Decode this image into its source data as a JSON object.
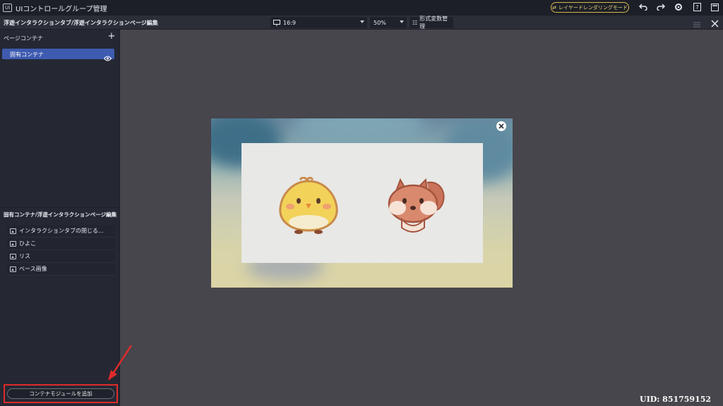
{
  "titlebar": {
    "logo": "UI",
    "title": "UIコントロールグループ管理",
    "mode_button": "レイヤードレンダリングモード",
    "icons": [
      "undo-icon",
      "redo-icon",
      "settings-icon",
      "help-icon",
      "minimize-icon"
    ]
  },
  "toolbar": {
    "breadcrumb": "浮遊インタラクションタブ/浮遊インタラクションページ編集",
    "aspect": "16:9",
    "zoom": "50%",
    "format_label": "形式変数管理"
  },
  "sidebar": {
    "header": "ページコンテナ",
    "pages": [
      {
        "label": "固有コンテナ",
        "selected": true
      }
    ],
    "section_title": "固有コンテナ/浮遊インタラクションページ編集",
    "items": [
      {
        "label": "インタラクションタブの閉じる...",
        "icon": "image-icon"
      },
      {
        "label": "ひよこ",
        "icon": "image-icon"
      },
      {
        "label": "リス",
        "icon": "image-icon"
      },
      {
        "label": "ベース画像",
        "icon": "image-icon"
      }
    ],
    "add_button": "コンテナモジュールを追加"
  },
  "canvas": {
    "characters": [
      "chick-character",
      "squirrel-character"
    ]
  },
  "uid": "UID: 851759152",
  "colors": {
    "accent": "#3e5bb0",
    "highlight": "#e02a2a",
    "mode_border": "#d8b74a"
  }
}
